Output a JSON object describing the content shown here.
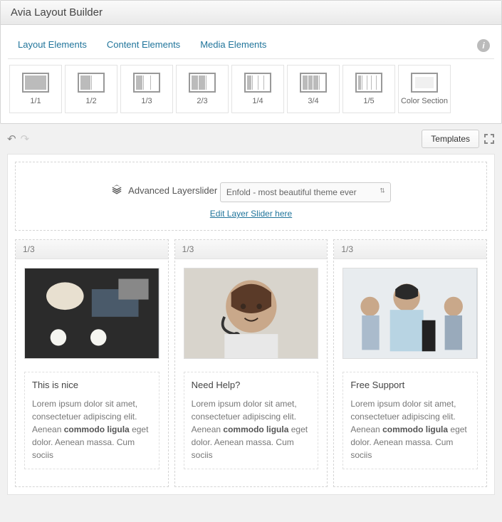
{
  "header": {
    "title": "Avia Layout Builder"
  },
  "tabs": [
    {
      "label": "Layout Elements",
      "active": true
    },
    {
      "label": "Content Elements",
      "active": false
    },
    {
      "label": "Media Elements",
      "active": false
    }
  ],
  "layout_elements": [
    {
      "label": "1/1"
    },
    {
      "label": "1/2"
    },
    {
      "label": "1/3"
    },
    {
      "label": "2/3"
    },
    {
      "label": "1/4"
    },
    {
      "label": "3/4"
    },
    {
      "label": "1/5"
    },
    {
      "label": "Color Section"
    }
  ],
  "toolbar": {
    "templates_label": "Templates"
  },
  "slider": {
    "title": "Advanced Layerslider",
    "selected": "Enfold - most beautiful theme ever",
    "edit_link": "Edit Layer Slider here"
  },
  "columns": [
    {
      "size": "1/3",
      "text_title": "This is nice",
      "text_body_1": "Lorem ipsum dolor sit amet, consectetuer adipiscing elit. Aenean ",
      "text_bold": "commodo ligula",
      "text_body_2": " eget dolor. Aenean massa. Cum sociis"
    },
    {
      "size": "1/3",
      "text_title": "Need Help?",
      "text_body_1": "Lorem ipsum dolor sit amet, consectetuer adipiscing elit. Aenean ",
      "text_bold": "commodo ligula",
      "text_body_2": " eget dolor. Aenean massa. Cum sociis"
    },
    {
      "size": "1/3",
      "text_title": "Free Support",
      "text_body_1": "Lorem ipsum dolor sit amet, consectetuer adipiscing elit. Aenean ",
      "text_bold": "commodo ligula",
      "text_body_2": " eget dolor. Aenean massa. Cum sociis"
    }
  ]
}
